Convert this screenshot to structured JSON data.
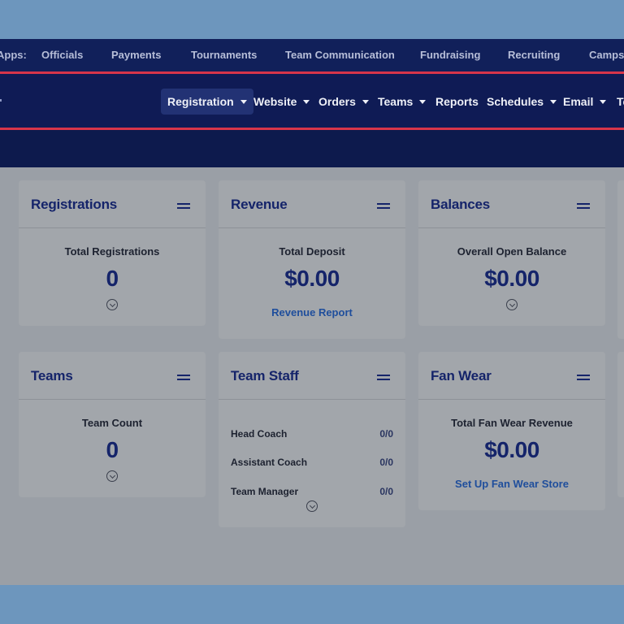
{
  "apps_bar": {
    "label": "Apps:",
    "links": [
      "Officials",
      "Payments",
      "Tournaments",
      "Team Communication",
      "Fundraising",
      "Recruiting",
      "Camps"
    ]
  },
  "nav": {
    "items": [
      {
        "label": "Registration",
        "dropdown": true,
        "active": true
      },
      {
        "label": "Website",
        "dropdown": true
      },
      {
        "label": "Orders",
        "dropdown": true
      },
      {
        "label": "Teams",
        "dropdown": true
      },
      {
        "label": "Reports",
        "dropdown": false
      },
      {
        "label": "Schedules",
        "dropdown": true
      },
      {
        "label": "Email",
        "dropdown": true
      },
      {
        "label": "Te",
        "dropdown": false
      }
    ]
  },
  "cards": {
    "registrations": {
      "title": "Registrations",
      "metric_label": "Total Registrations",
      "metric_value": "0"
    },
    "revenue": {
      "title": "Revenue",
      "metric_label": "Total Deposit",
      "metric_value": "$0.00",
      "link": "Revenue Report"
    },
    "balances": {
      "title": "Balances",
      "metric_label": "Overall Open Balance",
      "metric_value": "$0.00"
    },
    "teams": {
      "title": "Teams",
      "metric_label": "Team Count",
      "metric_value": "0"
    },
    "team_staff": {
      "title": "Team Staff",
      "rows": [
        {
          "role": "Head Coach",
          "count": "0/0"
        },
        {
          "role": "Assistant Coach",
          "count": "0/0"
        },
        {
          "role": "Team Manager",
          "count": "0/0"
        }
      ]
    },
    "fan_wear": {
      "title": "Fan Wear",
      "metric_label": "Total Fan Wear Revenue",
      "metric_value": "$0.00",
      "link": "Set Up Fan Wear Store"
    }
  },
  "colors": {
    "outer_background": "#6d96bd",
    "nav_background": "#0f1b55",
    "accent_red": "#d7354a",
    "title_navy": "#15246a",
    "link_blue": "#1f4e9c"
  }
}
